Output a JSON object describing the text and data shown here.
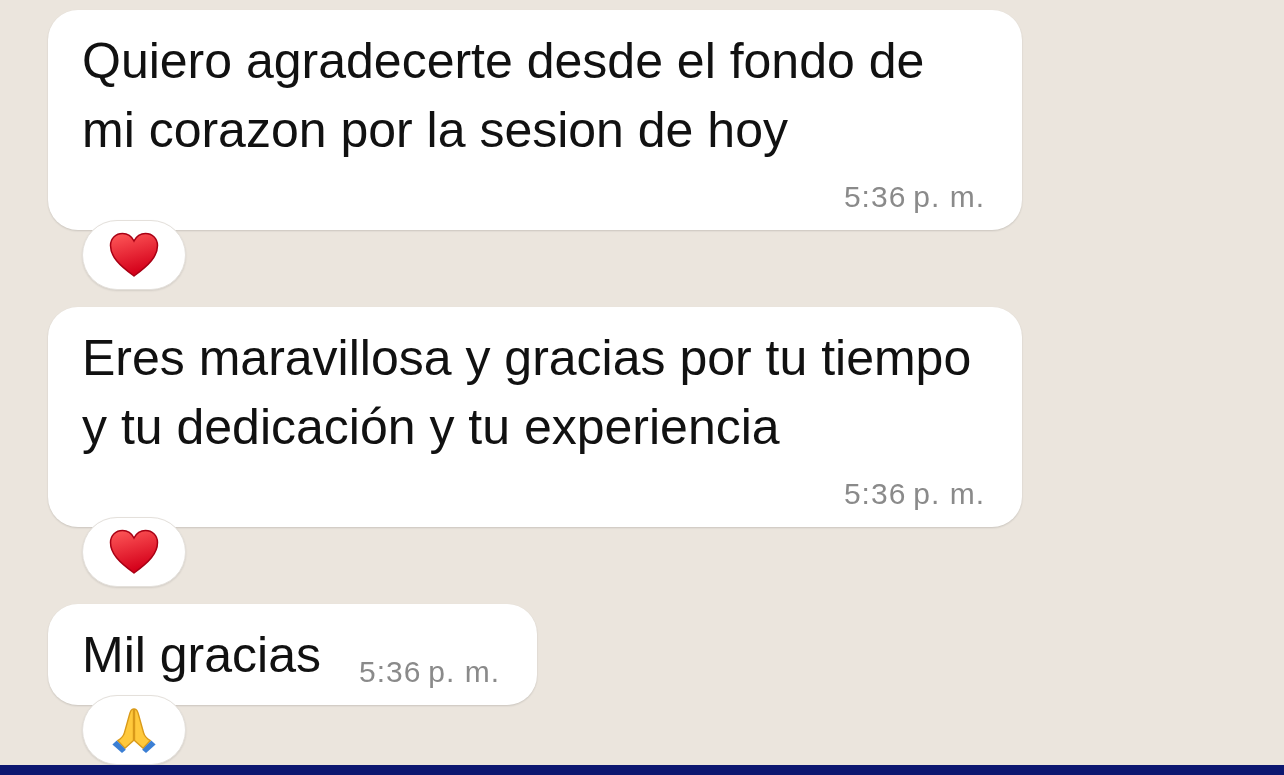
{
  "messages": [
    {
      "text": "Quiero agradecerte desde el fondo de mi corazon por la sesion de hoy",
      "time": "5:36 p. m.",
      "reaction": {
        "kind": "heart"
      }
    },
    {
      "text": "Eres maravillosa y gracias por tu tiempo y tu dedicación y tu experiencia",
      "time": "5:36 p. m.",
      "reaction": {
        "kind": "heart"
      }
    },
    {
      "text": "Mil gracias",
      "time": "5:36 p. m.",
      "reaction": {
        "kind": "pray"
      }
    }
  ]
}
